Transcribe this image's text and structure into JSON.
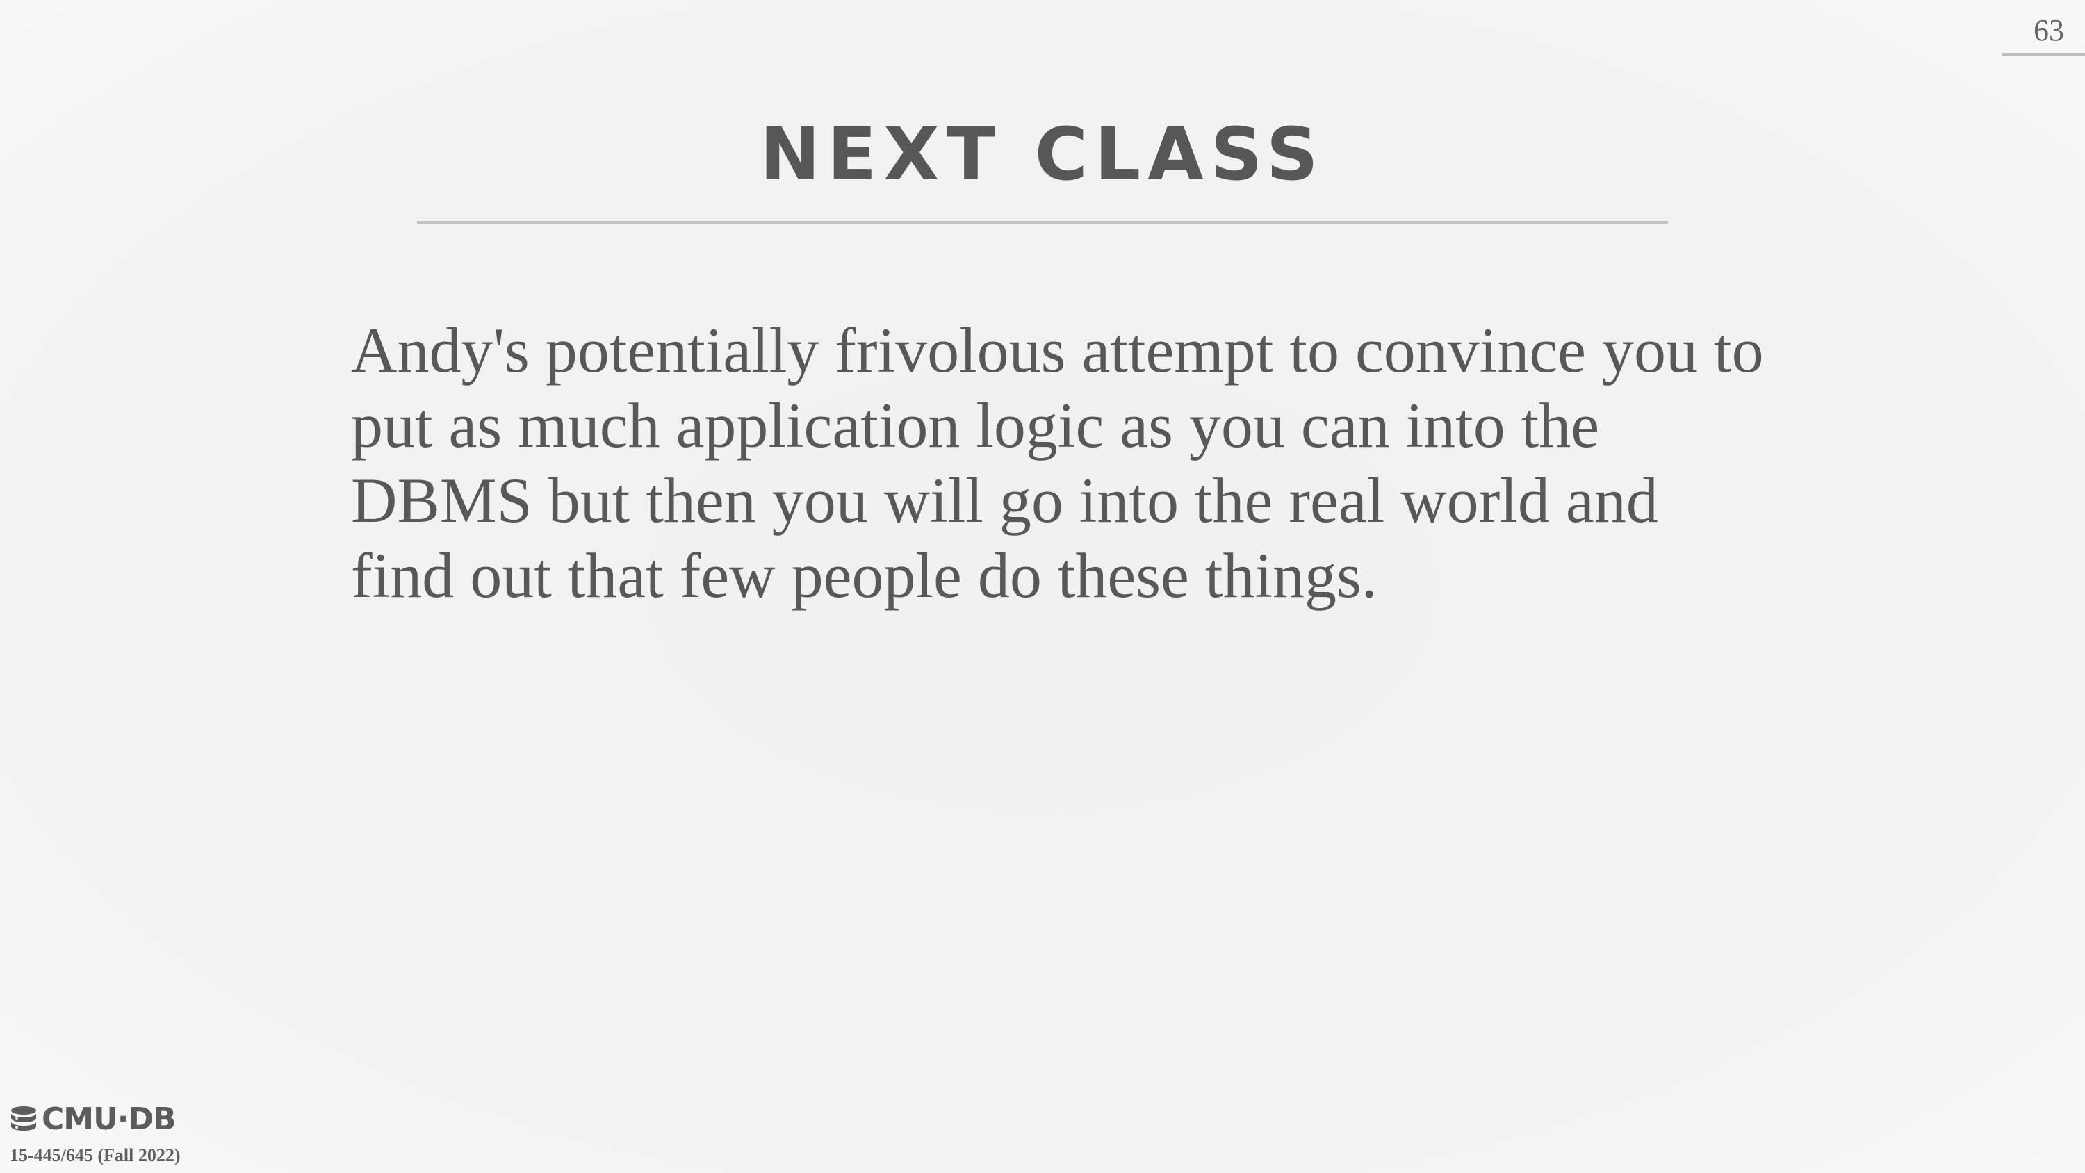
{
  "slide": {
    "page_number": "63",
    "title": "NEXT CLASS",
    "body": "Andy's potentially frivolous attempt to convince you to put as much application logic as you can into the DBMS but then you will go into the real world and find out that few people do these things."
  },
  "footer": {
    "logo_text": "CMU·DB",
    "logo_icon": "database-icon",
    "course": "15-445/645 (Fall 2022)"
  }
}
